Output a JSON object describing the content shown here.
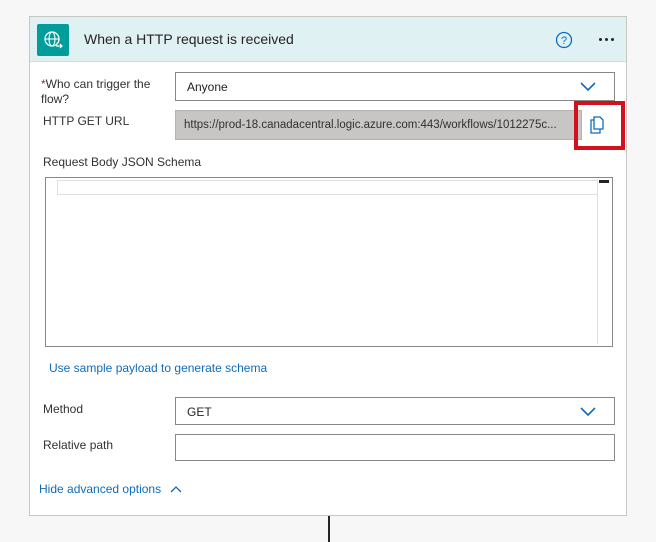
{
  "header": {
    "title": "When a HTTP request is received",
    "icon": "http-globe-icon",
    "accent_color": "#009d9a"
  },
  "fields": {
    "who_can_trigger": {
      "label": "Who can trigger the flow?",
      "required_marker": "*",
      "value": "Anyone"
    },
    "http_get_url": {
      "label": "HTTP GET URL",
      "value": "https://prod-18.canadacentral.logic.azure.com:443/workflows/1012275c..."
    },
    "request_body_schema": {
      "label": "Request Body JSON Schema",
      "value": ""
    },
    "method": {
      "label": "Method",
      "value": "GET"
    },
    "relative_path": {
      "label": "Relative path",
      "value": ""
    }
  },
  "links": {
    "sample_payload": "Use sample payload to generate schema",
    "hide_advanced": "Hide advanced options"
  },
  "colors": {
    "highlight": "#d1121e",
    "link": "#0f6cbd"
  }
}
